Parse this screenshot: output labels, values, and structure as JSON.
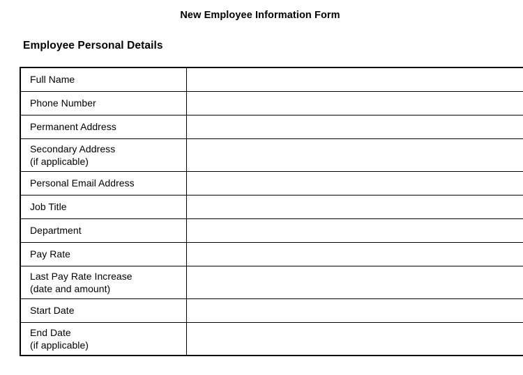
{
  "document": {
    "title": "New Employee Information Form",
    "section_heading": "Employee Personal Details"
  },
  "colors": {
    "page_background": "#ffffff",
    "text": "#000000",
    "border": "#000000"
  },
  "form": {
    "rows": [
      {
        "label": "Full Name",
        "sublabel": "",
        "value": ""
      },
      {
        "label": "Phone Number",
        "sublabel": "",
        "value": ""
      },
      {
        "label": "Permanent Address",
        "sublabel": "",
        "value": ""
      },
      {
        "label": "Secondary Address",
        "sublabel": "(if applicable)",
        "value": ""
      },
      {
        "label": "Personal Email Address",
        "sublabel": "",
        "value": ""
      },
      {
        "label": "Job Title",
        "sublabel": "",
        "value": ""
      },
      {
        "label": "Department",
        "sublabel": "",
        "value": ""
      },
      {
        "label": "Pay Rate",
        "sublabel": "",
        "value": ""
      },
      {
        "label": "Last Pay Rate Increase",
        "sublabel": "(date and amount)",
        "value": ""
      },
      {
        "label": "Start Date",
        "sublabel": "",
        "value": ""
      },
      {
        "label": "End Date",
        "sublabel": "(if applicable)",
        "value": ""
      }
    ]
  }
}
